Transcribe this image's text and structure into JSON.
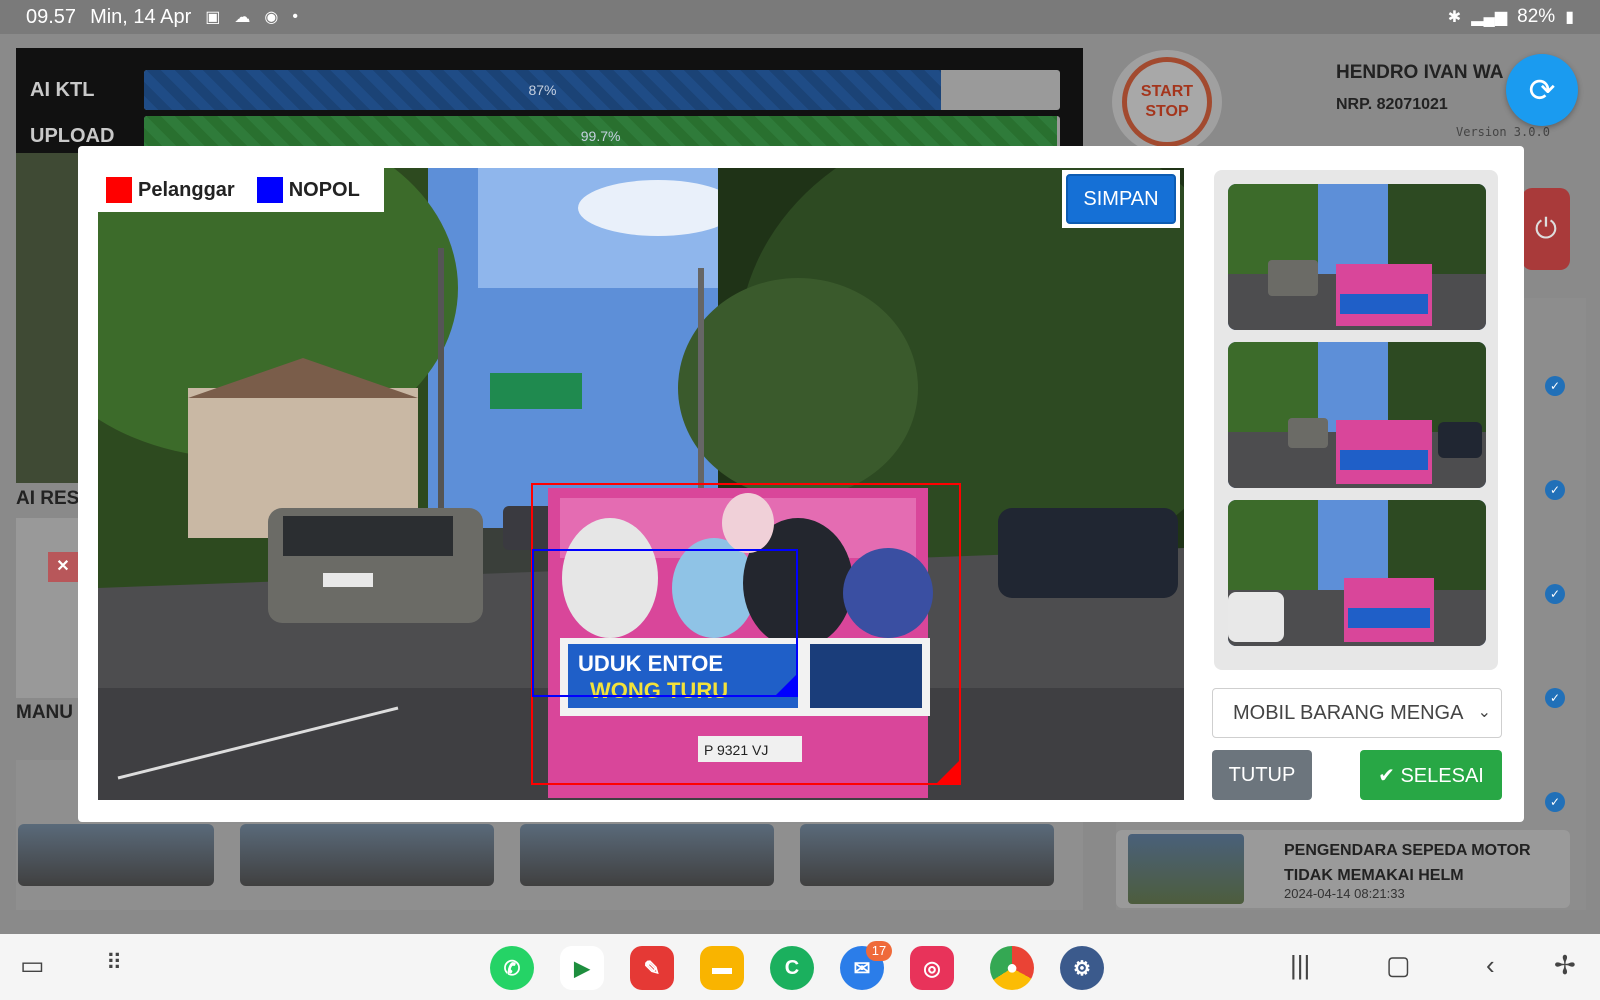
{
  "status_bar": {
    "time": "09.57",
    "date": "Min, 14 Apr",
    "battery": "82%"
  },
  "progress": [
    {
      "label": "AI KTL",
      "value_text": "87%",
      "value": 87
    },
    {
      "label": "UPLOAD",
      "value_text": "99.7%",
      "value": 99.7
    }
  ],
  "header": {
    "start_stop_line1": "START",
    "start_stop_line2": "STOP",
    "user_name": "HENDRO IVAN WA",
    "user_nrp": "NRP. 82071021",
    "version": "Version 3.0.0"
  },
  "background": {
    "ai_result_label": "AI RES",
    "manual_label": "MANU",
    "violation_title": "PENGENDARA SEPEDA MOTOR TIDAK MEMAKAI HELM",
    "violation_time": "2024-04-14 08:21:33"
  },
  "modal": {
    "legend": [
      {
        "label": "Pelanggar",
        "color": "#ff0000"
      },
      {
        "label": "NOPOL",
        "color": "#0000ff"
      }
    ],
    "save_label": "SIMPAN",
    "violation_select_value": "MOBIL BARANG MENGA",
    "close_label": "TUTUP",
    "finish_label": "SELESAI",
    "plate_text": "P 9321 VJ",
    "truck_sign_line1": "UDUK ENTOE",
    "truck_sign_line2": "WONG TURU"
  },
  "nav_bar": {
    "messages_badge": "17"
  },
  "colors": {
    "primary": "#1570d6",
    "success": "#28a745",
    "secondary": "#6c757d",
    "fab": "#1a9bf0"
  }
}
